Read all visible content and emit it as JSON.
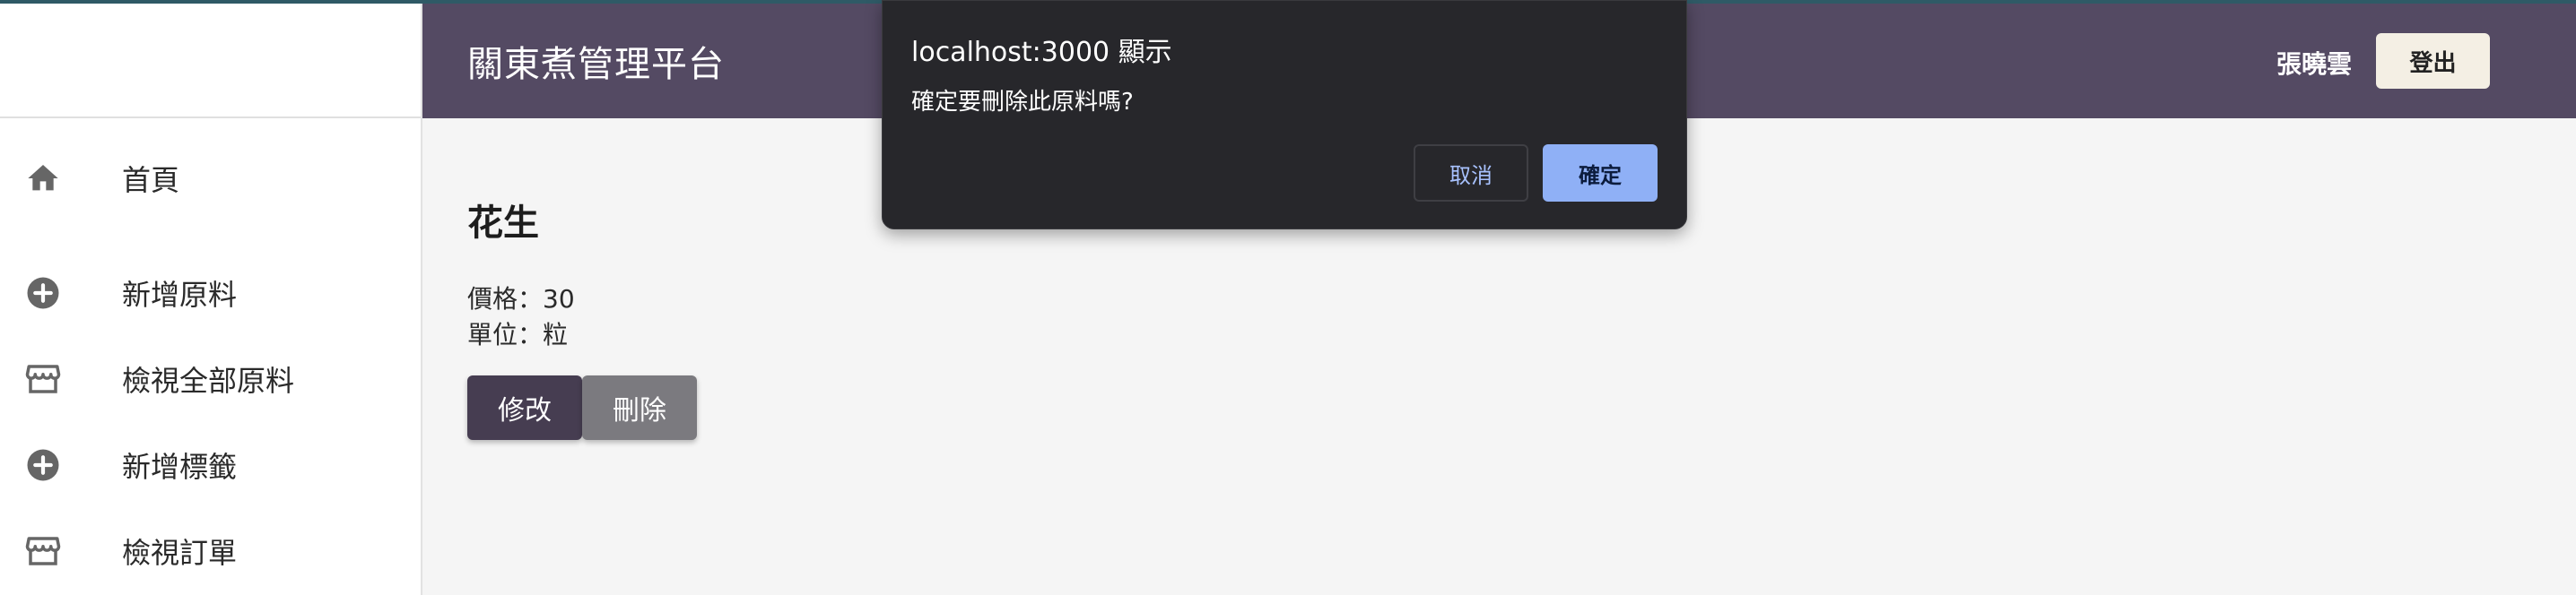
{
  "header": {
    "title": "關東煮管理平台",
    "user_name": "張曉雲",
    "logout_label": "登出"
  },
  "sidebar": {
    "items": [
      {
        "label": "首頁",
        "icon": "home-icon"
      },
      {
        "label": "新增原料",
        "icon": "add-circle-icon"
      },
      {
        "label": "檢視全部原料",
        "icon": "store-icon"
      },
      {
        "label": "新增標籤",
        "icon": "add-circle-icon"
      },
      {
        "label": "檢視訂單",
        "icon": "store-icon"
      }
    ]
  },
  "main": {
    "item_name": "花生",
    "price_text": "價格：30",
    "unit_text": "單位：粒",
    "edit_label": "修改",
    "delete_label": "刪除"
  },
  "dialog": {
    "title": "localhost:3000 顯示",
    "message": "確定要刪除此原料嗎?",
    "cancel_label": "取消",
    "confirm_label": "確定"
  },
  "colors": {
    "header_bg": "#544a63",
    "primary_button": "#463d51",
    "secondary_button": "#7b7a7f",
    "dialog_bg": "#27272b",
    "dialog_confirm": "#8fb0f6"
  }
}
